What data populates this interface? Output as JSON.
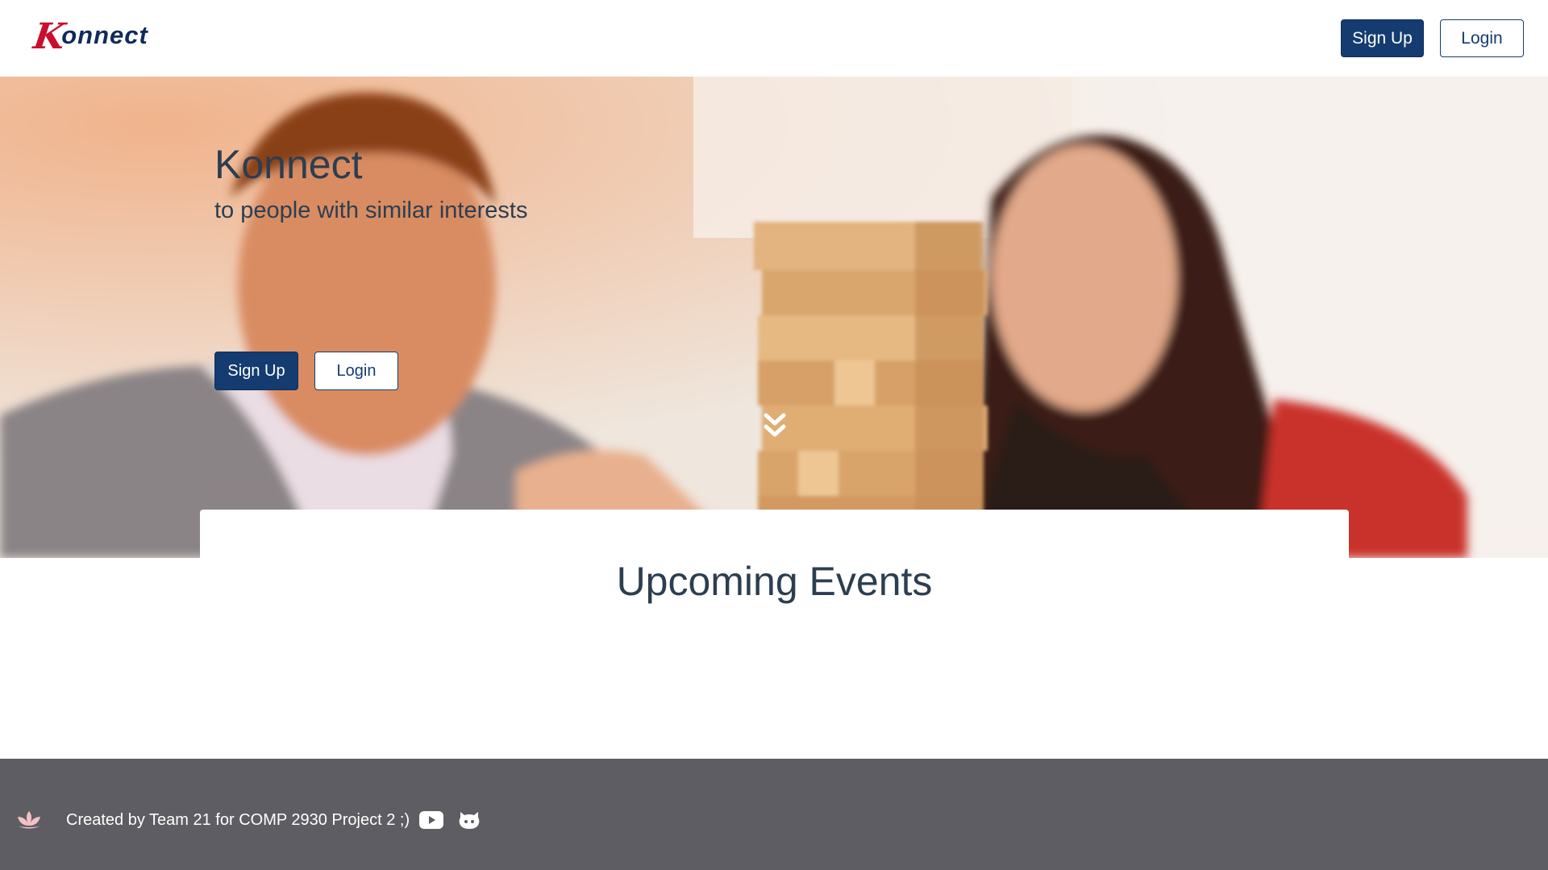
{
  "navbar": {
    "logo_k": "K",
    "logo_rest": "onnect",
    "signup_label": "Sign Up",
    "login_label": "Login"
  },
  "hero": {
    "title": "Konnect",
    "subtitle": "to people with similar interests",
    "signup_label": "Sign Up",
    "login_label": "Login",
    "scroll_icon": "double-chevron-down-icon"
  },
  "events": {
    "title": "Upcoming Events"
  },
  "footer": {
    "text": "Created by Team 21 for COMP 2930 Project 2 ;)",
    "icons": [
      "lotus-icon",
      "youtube-icon",
      "github-icon"
    ]
  },
  "colors": {
    "primary": "#143c70",
    "logo_red": "#c8102e",
    "text": "#2c3e50",
    "footer_bg": "#5e5d63"
  }
}
